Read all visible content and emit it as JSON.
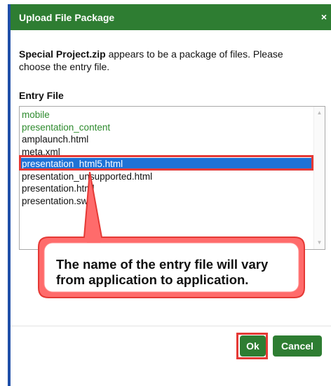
{
  "dialog": {
    "title": "Upload File Package",
    "close_glyph": "×",
    "message_filename": "Special Project.zip",
    "message_text": "appears to be a package of files. Please choose the entry file.",
    "entry_label": "Entry File",
    "items": [
      {
        "label": "mobile",
        "kind": "folder"
      },
      {
        "label": "presentation_content",
        "kind": "folder"
      },
      {
        "label": "amplaunch.html",
        "kind": "file"
      },
      {
        "label": "meta.xml",
        "kind": "file"
      },
      {
        "label": "presentation_html5.html",
        "kind": "file",
        "selected": true
      },
      {
        "label": "presentation_unsupported.html",
        "kind": "file"
      },
      {
        "label": "presentation.html",
        "kind": "file"
      },
      {
        "label": "presentation.swf",
        "kind": "file"
      }
    ],
    "callout_line1": "The name of the entry file will vary",
    "callout_line2": "from application to application.",
    "ok_label": "Ok",
    "cancel_label": "Cancel",
    "colors": {
      "accent": "#2e7d32",
      "selection": "#1e72d6",
      "folder": "#2e8b2e",
      "highlight": "#e53935"
    }
  }
}
